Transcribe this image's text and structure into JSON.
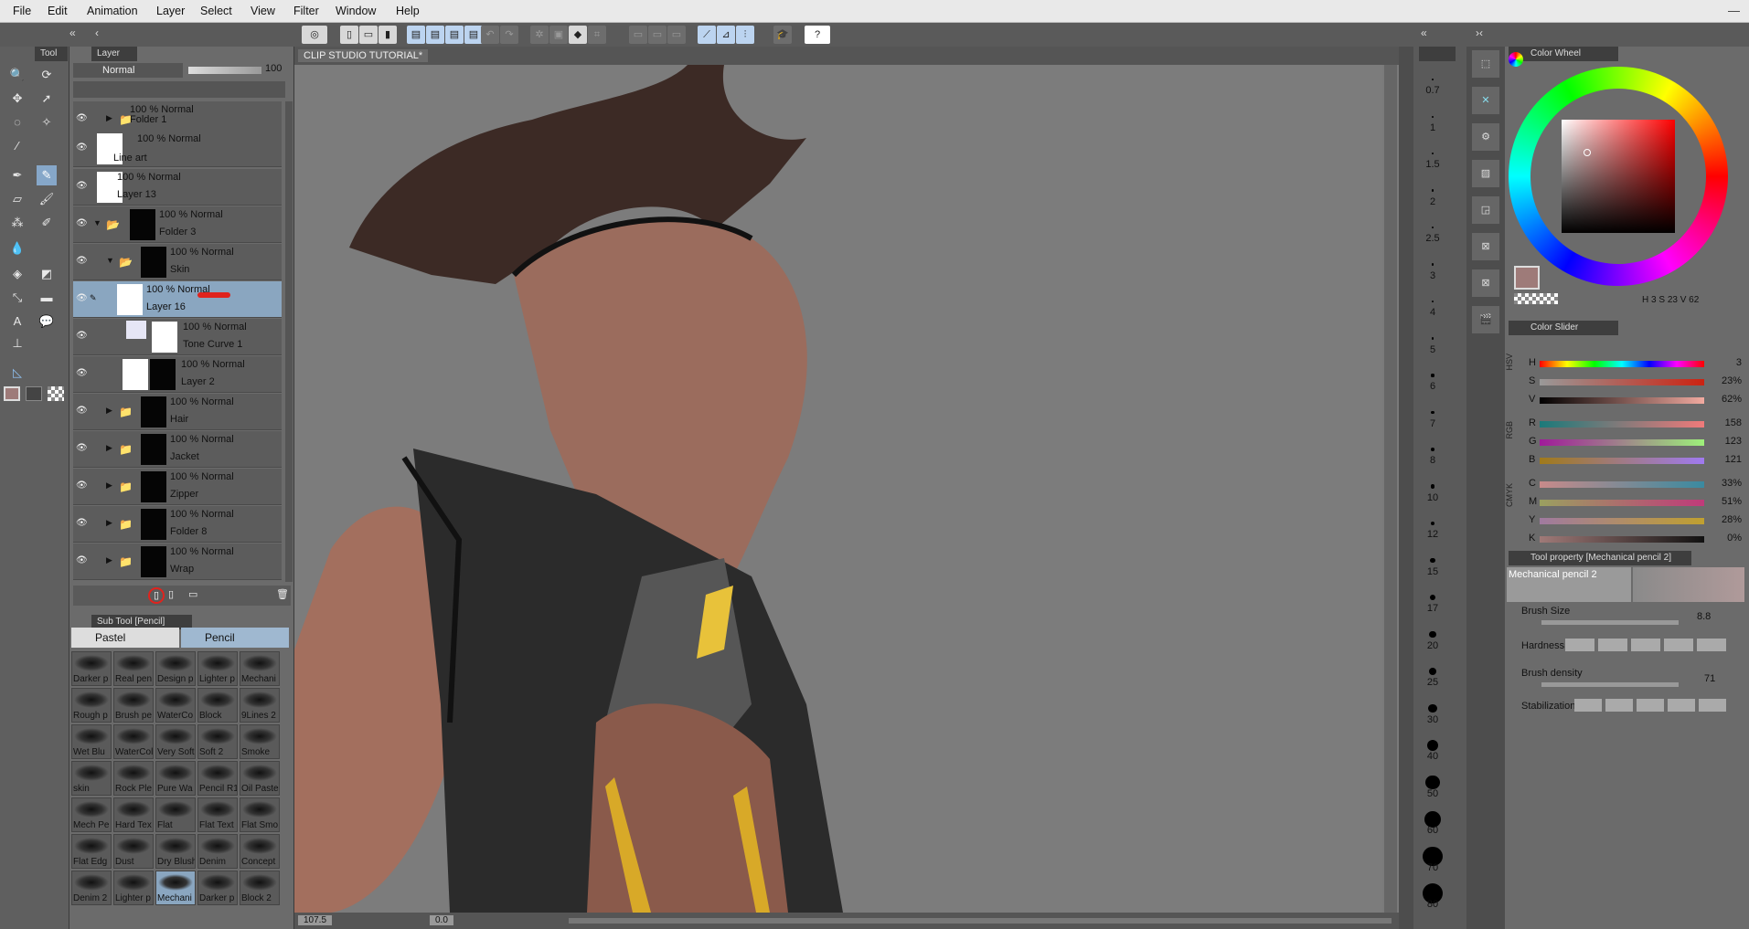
{
  "menu": [
    "File",
    "Edit",
    "Animation",
    "Layer",
    "Select",
    "View",
    "Filter",
    "Window",
    "Help"
  ],
  "tool_panel": {
    "tab": "Tool"
  },
  "layer_panel": {
    "tab": "Layer",
    "blend_mode": "Normal",
    "opacity": "100",
    "layers": [
      {
        "line1": "100 % Normal",
        "line2": "Folder 1"
      },
      {
        "line1": "100 % Normal",
        "line2": "Line art"
      },
      {
        "line1": "100 % Normal",
        "line2": "Layer 13"
      },
      {
        "line1": "100 % Normal",
        "line2": "Folder 3"
      },
      {
        "line1": "100 % Normal",
        "line2": "Skin"
      },
      {
        "line1": "100 % Normal",
        "line2": "Layer 16"
      },
      {
        "line1": "100 % Normal",
        "line2": "Tone Curve 1"
      },
      {
        "line1": "100 % Normal",
        "line2": "Layer 2"
      },
      {
        "line1": "100 % Normal",
        "line2": "Hair"
      },
      {
        "line1": "100 % Normal",
        "line2": "Jacket"
      },
      {
        "line1": "100 % Normal",
        "line2": "Zipper"
      },
      {
        "line1": "100 % Normal",
        "line2": "Folder 8"
      },
      {
        "line1": "100 % Normal",
        "line2": "Wrap"
      }
    ]
  },
  "subtool_panel": {
    "tab": "Sub Tool [Pencil]",
    "groups": [
      "Pastel",
      "Pencil"
    ],
    "brushes": [
      "Darker p",
      "Real pen",
      "Design p",
      "Lighter p",
      "Mechani",
      "Rough p",
      "Brush pe",
      "WaterCo",
      "Block",
      "9Lines 2",
      "Wet Blu",
      "WaterCol",
      "Very Soft",
      "Soft 2",
      "Smoke",
      "skin",
      "Rock Ple",
      "Pure Wa",
      "Pencil R1",
      "Oil Pastel",
      "Mech Pe",
      "Hard Tex",
      "Flat",
      "Flat Text",
      "Flat Smo",
      "Flat Edg",
      "Dust",
      "Dry Blush",
      "Denim",
      "Concept",
      "Denim 2",
      "Lighter p",
      "Mechani",
      "Darker p",
      "Block 2"
    ]
  },
  "canvas": {
    "tab": "CLIP STUDIO TUTORIAL*",
    "zoom": "107.5",
    "angle": "0.0"
  },
  "brush_sizes": [
    "0.7",
    "1",
    "1.5",
    "2",
    "2.5",
    "3",
    "4",
    "5",
    "6",
    "7",
    "8",
    "10",
    "12",
    "15",
    "17",
    "20",
    "25",
    "30",
    "40",
    "50",
    "60",
    "70",
    "80"
  ],
  "color_wheel": {
    "title": "Color Wheel",
    "h": "3",
    "s": "23",
    "v": "62",
    "h_label": "H",
    "s_label": "S",
    "v_label": "V",
    "swatch": "#9e7b79"
  },
  "color_slider": {
    "title": "Color Slider",
    "hsv_tab": "HSV",
    "rgb_tab": "RGB",
    "cmyk_tab": "CMYK",
    "rows": [
      {
        "label": "H",
        "value": "3"
      },
      {
        "label": "S",
        "value": "23%"
      },
      {
        "label": "V",
        "value": "62%"
      },
      {
        "label": "R",
        "value": "158"
      },
      {
        "label": "G",
        "value": "123"
      },
      {
        "label": "B",
        "value": "121"
      },
      {
        "label": "C",
        "value": "33%"
      },
      {
        "label": "M",
        "value": "51%"
      },
      {
        "label": "Y",
        "value": "28%"
      },
      {
        "label": "K",
        "value": "0%"
      }
    ]
  },
  "tool_property": {
    "title": "Tool property [Mechanical pencil 2]",
    "tool_name": "Mechanical pencil 2",
    "brush_size_label": "Brush Size",
    "brush_size": "8.8",
    "hardness_label": "Hardness",
    "density_label": "Brush density",
    "density": "71",
    "stabilization_label": "Stabilization"
  }
}
